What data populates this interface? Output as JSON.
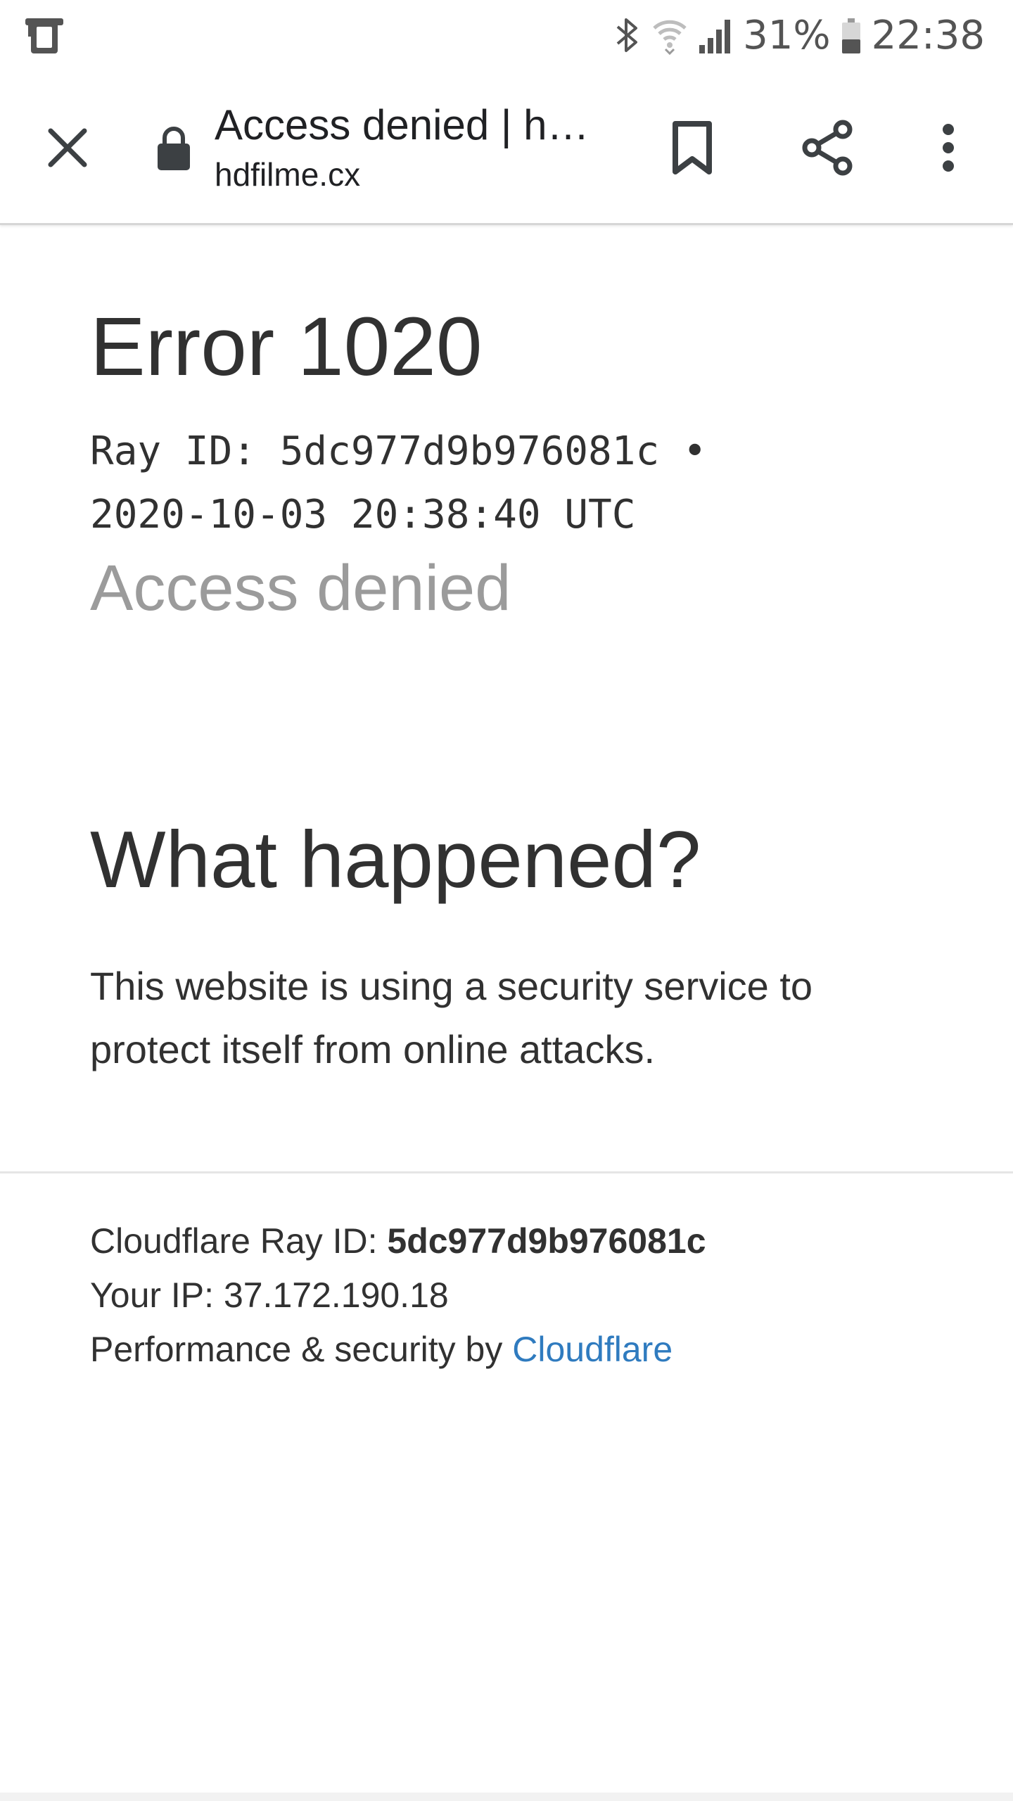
{
  "status_bar": {
    "left_icon": "device-notification-icon",
    "icons": [
      "bluetooth-icon",
      "wifi-icon",
      "signal-icon"
    ],
    "battery_percent": "31%",
    "battery_icon": "battery-icon",
    "time": "22:38"
  },
  "toolbar": {
    "close_icon": "close-icon",
    "lock_icon": "lock-icon",
    "title": "Access denied | h…",
    "url": "hdfilme.cx",
    "bookmark_icon": "bookmark-icon",
    "share_icon": "share-icon",
    "menu_icon": "more-vert-icon"
  },
  "page": {
    "error_title": "Error 1020",
    "ray_line_1": "Ray ID: 5dc977d9b976081c •",
    "ray_line_2": "2020-10-03 20:38:40 UTC",
    "access_denied": "Access denied",
    "what_happened": "What happened?",
    "explanation": "This website is using a security service to protect itself from online attacks."
  },
  "footer": {
    "ray_label": "Cloudflare Ray ID: ",
    "ray_id": "5dc977d9b976081c",
    "ip_text": "Your IP: 37.172.190.18",
    "perf_text": "Performance & security by ",
    "cloudflare_link": "Cloudflare"
  },
  "colors": {
    "text": "#313131",
    "muted": "#9b9b9b",
    "link": "#2f7bbf",
    "status_icons": "#545454"
  }
}
